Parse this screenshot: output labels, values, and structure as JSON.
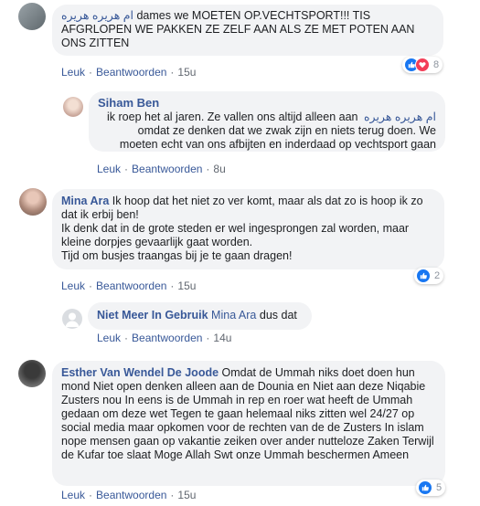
{
  "comments": [
    {
      "mention": "ام هريره هريره",
      "text": " dames we MOETEN OP.VECHTSPORT!!! TIS AFGRLOPEN WE PAKKEN ZE ZELF AAN ALS ZE MET POTEN AAN ONS ZITTEN",
      "like_label": "Leuk",
      "reply_label": "Beantwoorden",
      "time": "15u",
      "reaction_count": "8"
    },
    {
      "author": "Siham Ben",
      "line1": "ik roep het al jaren. Ze vallen ons altijd alleen aan",
      "mention": "ام هريره هريره",
      "line2": "omdat ze denken dat we zwak zijn en niets terug doen. We",
      "line3": "moeten echt van ons afbijten en inderdaad op vechtsport gaan",
      "like_label": "Leuk",
      "reply_label": "Beantwoorden",
      "time": "8u"
    },
    {
      "author": "Mina Ara",
      "text": " Ik hoop dat het niet zo ver komt, maar als dat zo is hoop ik zo dat ik erbij ben!",
      "line2": "Ik denk dat in de grote steden er wel ingesprongen zal worden, maar kleine dorpjes gevaarlijk gaat worden.",
      "line3": "Tijd om busjes traangas bij je te gaan dragen!",
      "like_label": "Leuk",
      "reply_label": "Beantwoorden",
      "time": "15u",
      "reaction_count": "2"
    },
    {
      "author": "Niet Meer In Gebruik",
      "mention": "Mina Ara",
      "text": " dus dat",
      "like_label": "Leuk",
      "reply_label": "Beantwoorden",
      "time": "14u"
    },
    {
      "author": "Esther Van Wendel De Joode",
      "text": " Omdat de Ummah niks doet doen hun mond Niet open denken alleen aan de Dounia en Niet aan deze Niqabie Zusters nou In eens is de Ummah in rep en roer wat heeft de Ummah gedaan om deze wet Tegen te gaan helemaal niks zitten wel 24/27 op social media maar opkomen voor de rechten van de de Zusters In islam nope mensen gaan op vakantie zeiken over ander nutteloze Zaken Terwijl de Kufar toe slaat Moge Allah Swt onze Ummah beschermen Ameen",
      "like_label": "Leuk",
      "reply_label": "Beantwoorden",
      "time": "15u",
      "reaction_count": "5"
    }
  ],
  "colors": {
    "link": "#385898",
    "bubble": "#f2f3f5",
    "like": "#1877f2",
    "love": "#f33e58"
  }
}
